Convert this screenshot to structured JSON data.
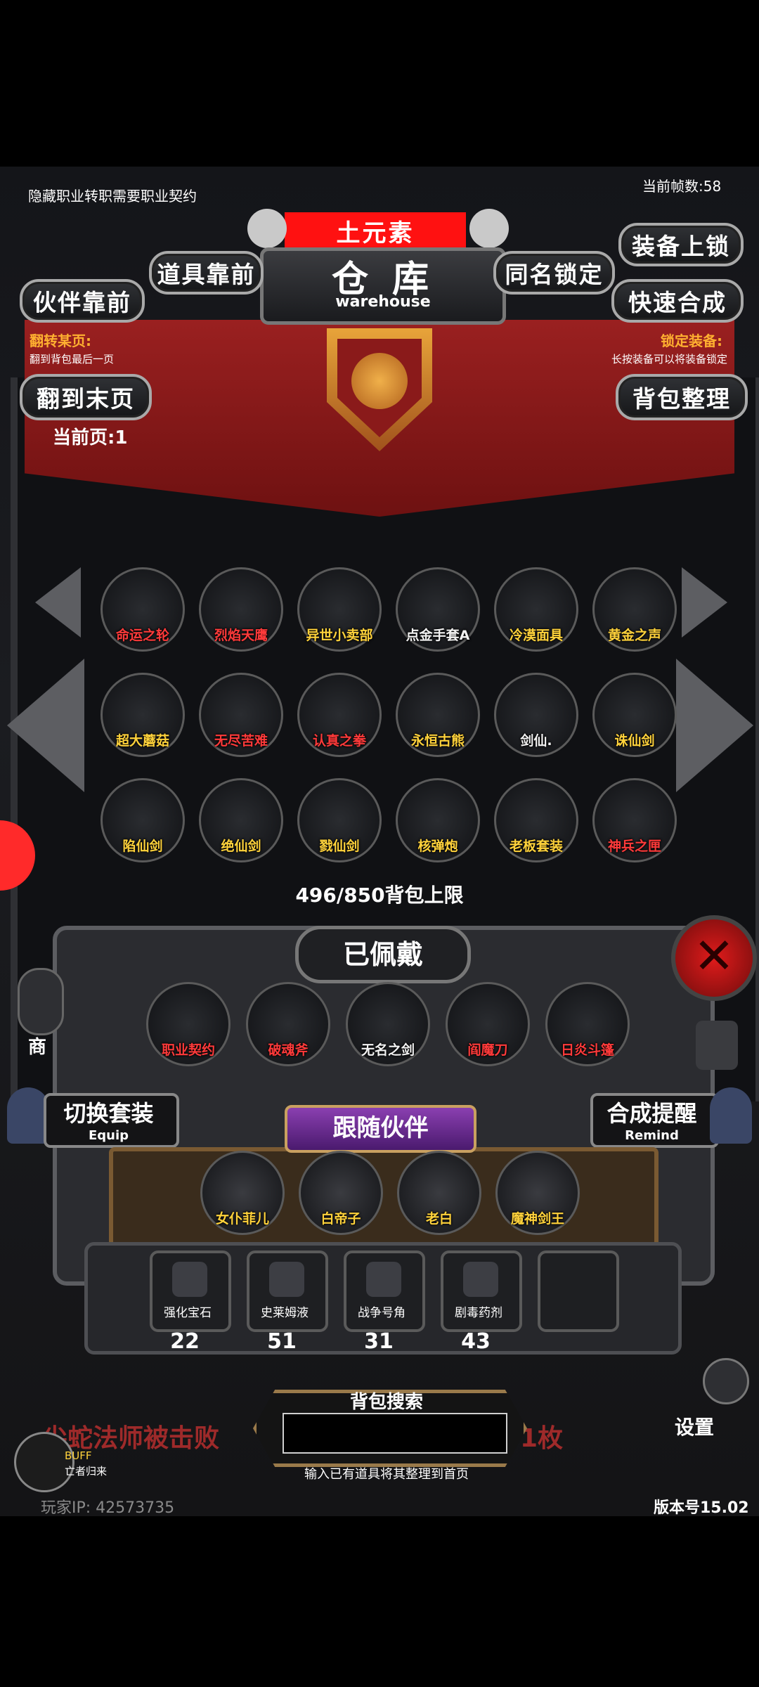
{
  "hud": {
    "hint": "隐藏职业转职需要职业契约",
    "fps": "当前帧数:58",
    "version": "版本号15.02",
    "player_ip": "玩家IP:  42573735",
    "buff": "BUFF",
    "buff_sub": "亡者归来"
  },
  "header": {
    "element": "土元素",
    "title": "仓 库",
    "subtitle": "warehouse"
  },
  "buttons": {
    "items_first": "道具靠前",
    "partners_first": "伙伴靠前",
    "same_name_lock": "同名锁定",
    "equip_lock": "装备上锁",
    "quick_merge": "快速合成",
    "to_last_page": "翻到末页",
    "sort_bag": "背包整理"
  },
  "flip_hint": {
    "title": "翻转某页:",
    "desc": "翻到背包最后一页"
  },
  "lock_hint": {
    "title": "锁定装备:",
    "desc": "长按装备可以将装备锁定"
  },
  "current_page": "当前页:1",
  "grid": [
    {
      "name": "命运之轮",
      "color": "red",
      "icon": "gold-wheel-icon"
    },
    {
      "name": "烈焰天鹰",
      "color": "red",
      "icon": "red-eagle-icon"
    },
    {
      "name": "异世小卖部",
      "color": "yellow",
      "icon": "shop-icon"
    },
    {
      "name": "点金手套A",
      "color": "white",
      "icon": "glove-icon"
    },
    {
      "name": "冷漠面具",
      "color": "yellow",
      "icon": "mask-icon"
    },
    {
      "name": "黄金之声",
      "color": "yellow",
      "icon": "harp-icon"
    },
    {
      "name": "超大蘑菇",
      "color": "yellow",
      "icon": "mushroom-icon"
    },
    {
      "name": "无尽苦难",
      "color": "red",
      "icon": "dark-knight-icon"
    },
    {
      "name": "认真之拳",
      "color": "red",
      "icon": "fist-icon"
    },
    {
      "name": "永恒古熊",
      "color": "yellow",
      "icon": "bear-icon"
    },
    {
      "name": "剑仙.",
      "color": "white",
      "icon": "sword-immortal-icon"
    },
    {
      "name": "诛仙剑",
      "color": "yellow",
      "icon": "sword-icon"
    },
    {
      "name": "陷仙剑",
      "color": "yellow",
      "icon": "sword-icon"
    },
    {
      "name": "绝仙剑",
      "color": "yellow",
      "icon": "sword-icon"
    },
    {
      "name": "戮仙剑",
      "color": "yellow",
      "icon": "sword-icon"
    },
    {
      "name": "核弹炮",
      "color": "yellow",
      "icon": "cannon-icon"
    },
    {
      "name": "老板套装",
      "color": "yellow",
      "icon": "boss-suit-icon"
    },
    {
      "name": "神兵之匣",
      "color": "red",
      "icon": "chest-icon"
    }
  ],
  "capacity": "496/850背包上限",
  "equipped": {
    "title": "已佩戴",
    "items": [
      {
        "name": "职业契约",
        "color": "red",
        "icon": "scroll-icon"
      },
      {
        "name": "破魂斧",
        "color": "red",
        "icon": "axe-icon"
      },
      {
        "name": "无名之剑",
        "color": "white",
        "icon": "sword-icon"
      },
      {
        "name": "阎魔刀",
        "color": "red",
        "icon": "katana-icon"
      },
      {
        "name": "日炎斗篷",
        "color": "red",
        "icon": "cloak-icon"
      }
    ]
  },
  "switch_set": {
    "label": "切换套装",
    "sub": "Equip"
  },
  "merge_remind": {
    "label": "合成提醒",
    "sub": "Remind"
  },
  "partners": {
    "title": "跟随伙伴",
    "items": [
      {
        "name": "女仆菲儿",
        "icon": "maid-icon"
      },
      {
        "name": "白帝子",
        "icon": "white-bird-icon"
      },
      {
        "name": "老白",
        "icon": "dolphin-icon"
      },
      {
        "name": "魔神剑王",
        "icon": "demon-sword-king-icon"
      }
    ]
  },
  "consumables": [
    {
      "name": "强化宝石",
      "count": "22",
      "icon": "green-gem-icon"
    },
    {
      "name": "史莱姆液",
      "count": "51",
      "icon": "potion-icon"
    },
    {
      "name": "战争号角",
      "count": "31",
      "icon": "horn-icon"
    },
    {
      "name": "剧毒药剂",
      "count": "43",
      "icon": "poison-icon"
    }
  ],
  "search": {
    "title": "背包搜索",
    "hint": "输入已有道具将其整理到首页",
    "value": ""
  },
  "side": {
    "shop": "商",
    "settings": "设置"
  },
  "scroll_text": "尖蛇法师被击败",
  "scroll_text_tail": "1枚",
  "colors": {
    "red_label": "#ff3a3a",
    "yellow_label": "#ffd23b",
    "banner": "#8a1a1a",
    "frame": "#5c5d61"
  }
}
